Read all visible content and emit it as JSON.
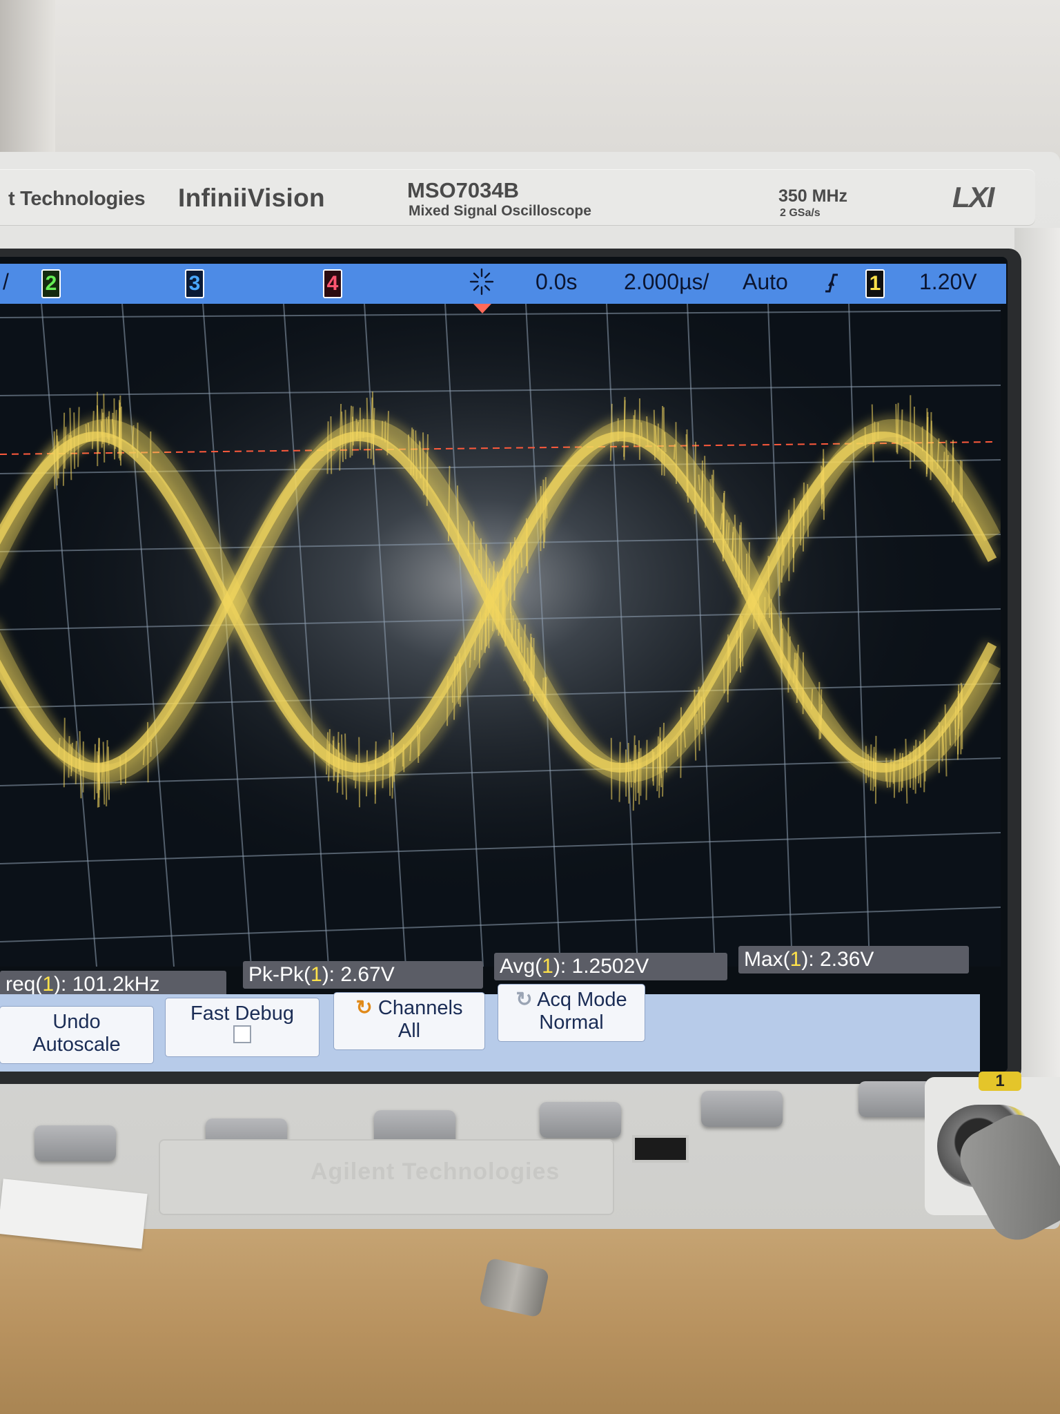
{
  "instrument": {
    "company": "t Technologies",
    "product_line": "InfiniiVision",
    "model": "MSO7034B",
    "description": "Mixed Signal Oscilloscope",
    "bandwidth": "350 MHz",
    "sample_rate": "2 GSa/s",
    "logo_lxi": "LXI",
    "panel_logo": "Agilent Technologies"
  },
  "status_bar": {
    "first_glyph": "/",
    "channels": [
      "2",
      "3",
      "4"
    ],
    "trigger_icon": "trigger-spark-icon",
    "time_offset": "0.0s",
    "time_per_div": "2.000µs/",
    "trigger_mode": "Auto",
    "trigger_slope_icon": "rising-edge-icon",
    "trigger_source": "1",
    "trigger_level": "1.20V"
  },
  "measurements": [
    {
      "prefix": "req(",
      "channel": "1",
      "suffix": "): 101.2kHz"
    },
    {
      "prefix": "Pk-Pk(",
      "channel": "1",
      "suffix": "): 2.67V"
    },
    {
      "prefix": "Avg(",
      "channel": "1",
      "suffix": "): 1.2502V"
    },
    {
      "prefix": "Max(",
      "channel": "1",
      "suffix": "): 2.36V"
    }
  ],
  "softkeys": [
    {
      "line1": "Undo",
      "line2": "Autoscale"
    },
    {
      "line1": "Fast Debug",
      "line2": ""
    },
    {
      "line1": "Channels",
      "line2": "All",
      "icon": "cycle-icon"
    },
    {
      "line1": "Acq Mode",
      "line2": "Normal",
      "icon": "cycle-icon"
    }
  ],
  "probe_channel_tab": "1",
  "colors": {
    "trace": "#f2d65e",
    "status_bar": "#4d8be6",
    "grid": "#8fa0b3",
    "trigger_line": "#ff5a3c"
  }
}
